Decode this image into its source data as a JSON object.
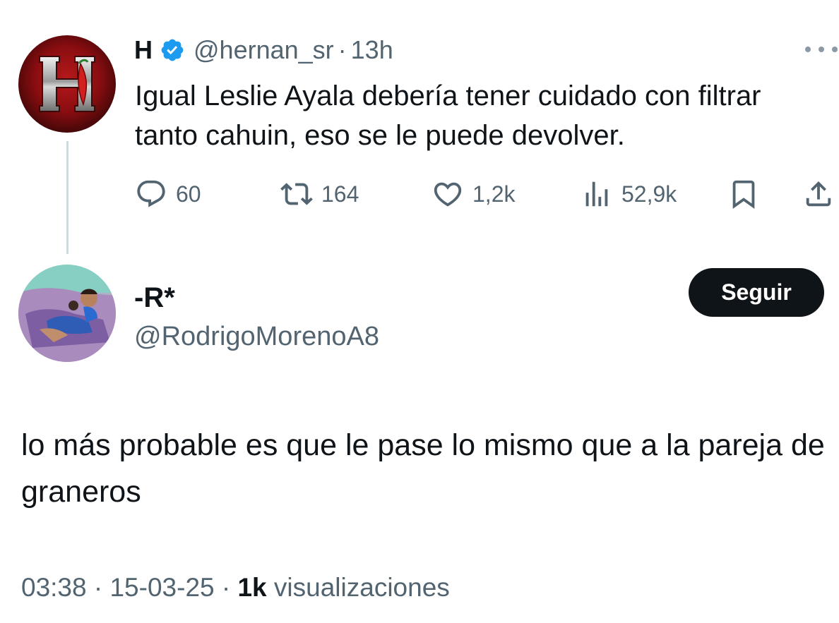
{
  "parent_tweet": {
    "name": "H",
    "handle": "@hernan_sr",
    "separator": "·",
    "time": "13h",
    "text": "Igual Leslie Ayala debería tener cuidado con filtrar tanto cahuin, eso se le puede devolver.",
    "avatar_letter": "H",
    "metrics": {
      "replies": "60",
      "retweets": "164",
      "likes": "1,2k",
      "views": "52,9k"
    }
  },
  "reply": {
    "name": "-R*",
    "handle": "@RodrigoMorenoA8",
    "follow_label": "Seguir",
    "text": "lo más probable es que le pase lo mismo que a la pareja de graneros",
    "time": "03:38",
    "sep1": "·",
    "date": "15-03-25",
    "sep2": "·",
    "views_count": "1k",
    "views_label": "visualizaciones"
  },
  "icons": {
    "verified": "verified-badge-icon",
    "more": "more-icon",
    "reply": "reply-icon",
    "retweet": "retweet-icon",
    "like": "heart-icon",
    "views": "views-icon",
    "bookmark": "bookmark-icon",
    "share": "share-icon"
  },
  "colors": {
    "text_primary": "#0f1419",
    "text_secondary": "#536471",
    "verified_blue": "#1d9bf0",
    "button_bg": "#0f1419",
    "thread_line": "#cfd9de"
  }
}
